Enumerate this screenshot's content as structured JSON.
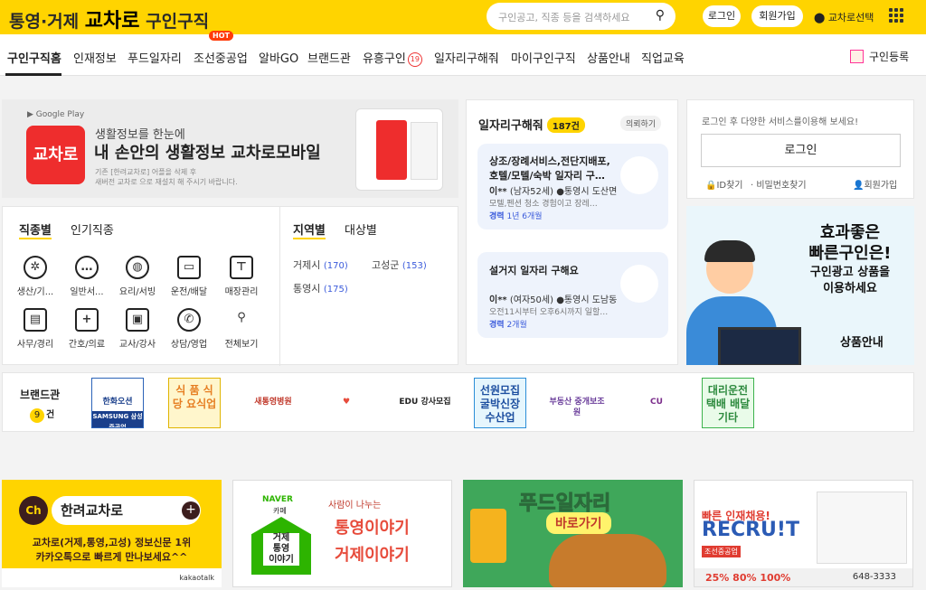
{
  "header": {
    "logo_prefix": "통영·거제",
    "logo_brand": "교차로",
    "logo_suffix": "구인구직",
    "search_placeholder": "구인공고, 직종 등을 검색하세요",
    "login": "로그인",
    "signup": "회원가입",
    "region_select": "교차로선택"
  },
  "nav": {
    "items": [
      "구인구직홈",
      "인재정보",
      "푸드일자리",
      "조선중공업",
      "알바GO",
      "브랜드관",
      "유흥구인",
      "일자리구해줘",
      "마이구인구직",
      "상품안내",
      "직업교육"
    ],
    "hot_badge": "HOT",
    "adult_badge": "19",
    "register": "구인등록"
  },
  "mobile_banner": {
    "store": "Google Play",
    "app_label": "교차로",
    "line1": "생활정보를 한눈에",
    "line2": "내 손안의 생활정보 교차로모바일",
    "note1": "기존 [한려교차로] 어플을 삭제 후",
    "note2": "새버전 교차로 으로 재설치 해 주시기 바랍니다."
  },
  "categories": {
    "tab_job": "직종별",
    "tab_popular": "인기직종",
    "tab_region": "지역별",
    "tab_target": "대상별",
    "jobs": [
      {
        "label": "생산/기...",
        "icon": "gear-icon"
      },
      {
        "label": "일반서...",
        "icon": "chat-icon"
      },
      {
        "label": "요리/서빙",
        "icon": "dish-icon"
      },
      {
        "label": "운전/배달",
        "icon": "truck-icon"
      },
      {
        "label": "매장관리",
        "icon": "shirt-icon"
      },
      {
        "label": "사무/경리",
        "icon": "desk-icon"
      },
      {
        "label": "간호/의료",
        "icon": "medical-icon"
      },
      {
        "label": "교사/강사",
        "icon": "teacher-icon"
      },
      {
        "label": "상담/영업",
        "icon": "phone-icon"
      },
      {
        "label": "전체보기",
        "icon": "search-icon"
      }
    ],
    "regions": [
      {
        "name": "거제시",
        "count": "(170)"
      },
      {
        "name": "고성군",
        "count": "(153)"
      },
      {
        "name": "통영시",
        "count": "(175)"
      }
    ]
  },
  "job_seekers": {
    "title": "일자리구해줘",
    "count": "187건",
    "request": "의뢰하기",
    "cards": [
      {
        "title": "상조/장례서비스,전단지배포,호텔/모텔/숙박 일자리 구…",
        "person": "이**",
        "meta": "(남자52세)",
        "location": "통영시 도산면",
        "desc": "모텔,펜션 청소 경험이고 장레…",
        "exp_label": "경력",
        "exp": "1년 6개월"
      },
      {
        "title": "설거지 일자리 구해요",
        "person": "이**",
        "meta": "(여자50세)",
        "location": "통영시 도남동",
        "desc": "오전11시부터 오후6시까지 일할…",
        "exp_label": "경력",
        "exp": "2개월"
      }
    ]
  },
  "login_box": {
    "message": "로그인 후 다양한 서비스를이용해 보세요!",
    "button": "로그인",
    "find_id": "ID찾기",
    "find_pw": "비밀번호찾기",
    "join": "회원가입"
  },
  "ad": {
    "headline1": "효과좋은",
    "headline2": "빠른구인은!",
    "sub1": "구인광고 상품을",
    "sub2": "이용하세요",
    "link": "상품안내"
  },
  "brand": {
    "label": "브랜드관",
    "count": "9",
    "unit": "건",
    "logos": [
      {
        "text": "한화오션",
        "sub": "SAMSUNG 삼성중공업",
        "color": "#1a3f8b",
        "bg": "#fff",
        "border": "#2b63b8"
      },
      {
        "text": "식 품 식 당 요식업",
        "sub": "",
        "color": "#e67e22",
        "bg": "#fff6cc",
        "border": "#e0b400"
      },
      {
        "text": "새통영병원",
        "sub": "",
        "color": "#c0392b",
        "bg": "#fff",
        "border": "#fff"
      },
      {
        "text": "♥",
        "sub": "",
        "color": "#e74c3c",
        "bg": "#fff",
        "border": "#fff"
      },
      {
        "text": "EDU 강사모집",
        "sub": "",
        "color": "#222",
        "bg": "#fff",
        "border": "#fff"
      },
      {
        "text": "선원모집 굴박신장 수산업",
        "sub": "",
        "color": "#1d4fa0",
        "bg": "#e6f6fd",
        "border": "#2b8ed8"
      },
      {
        "text": "부동산 중개보조원",
        "sub": "",
        "color": "#6a3d9a",
        "bg": "#fff",
        "border": "#fff"
      },
      {
        "text": "CU",
        "sub": "",
        "color": "#7b2d8b",
        "bg": "#fff",
        "border": "#fff"
      },
      {
        "text": "대리운전 택배 배달 기타",
        "sub": "",
        "color": "#2d8a3e",
        "bg": "#e9fbe9",
        "border": "#3cb34c"
      }
    ]
  },
  "bottom_banners": {
    "kakao": {
      "ch": "Ch",
      "name": "한려교차로",
      "line1": "교차로(거제,통영,고성) 정보신문 1위",
      "line2": "카카오톡으로 빠르게 만나보세요^^",
      "footer": "kakaotalk"
    },
    "naver": {
      "brand": "NAVER",
      "cafe": "카페",
      "house1": "거제",
      "house2": "통영",
      "house3": "이야기",
      "tag": "사람이 나누는",
      "r1": "통영이야기",
      "r2": "거제이야기"
    },
    "food": {
      "title": "푸드일자리",
      "go": "바로가기"
    },
    "recruit": {
      "line1": "빠른 인재채용!",
      "line2": "RECRU!T",
      "tag": "조선중공업",
      "strip": "25% 80% 100%",
      "phone": "648-3333"
    }
  }
}
